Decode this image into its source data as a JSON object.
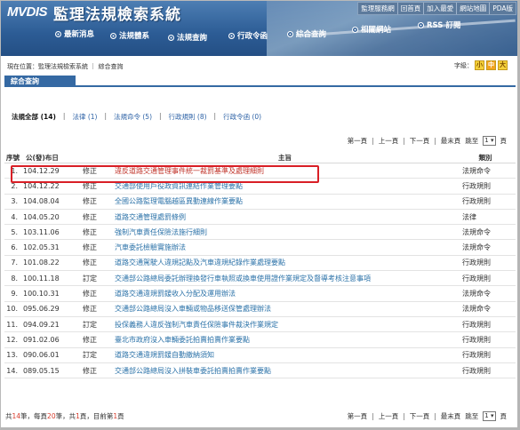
{
  "header": {
    "logo": "MVDIS",
    "title": "監理法規檢索系統",
    "top_links": [
      "監理服務網",
      "回首頁",
      "加入最愛",
      "網站地圖",
      "PDA版"
    ]
  },
  "nav": [
    {
      "label": "最新消息"
    },
    {
      "label": "法規體系"
    },
    {
      "label": "法規查詢"
    },
    {
      "label": "行政令函"
    },
    {
      "label": "綜合查詢"
    },
    {
      "label": "相關網站"
    },
    {
      "label": "RSS 訂閱"
    }
  ],
  "breadcrumb": "現在位置：監理法規檢索系統 ｜ 綜合查詢",
  "font_size": {
    "label": "字級：",
    "options": [
      "小",
      "中",
      "大"
    ],
    "active": 1
  },
  "section_title": "綜合查詢",
  "filters": [
    {
      "label": "法規全部 (14)",
      "current": true
    },
    {
      "label": "法律 (1)",
      "current": false
    },
    {
      "label": "法規命令 (5)",
      "current": false
    },
    {
      "label": "行政規則 (8)",
      "current": false
    },
    {
      "label": "行政令函 (0)",
      "current": false
    }
  ],
  "pager": {
    "first": "第一頁",
    "prev": "上一頁",
    "next": "下一頁",
    "last": "最末頁",
    "jump": "跳至",
    "page": "1",
    "page_suffix": "頁"
  },
  "table": {
    "headers": {
      "no": "序號",
      "date": "公(發)布日",
      "action": "",
      "title": "主旨",
      "category": "類別"
    },
    "rows": [
      {
        "no": "1.",
        "date": "104.12.29",
        "action": "修正",
        "title": "違反道路交通管理事件統一裁罰基準及處理細則",
        "category": "法規命令"
      },
      {
        "no": "2.",
        "date": "104.12.22",
        "action": "修正",
        "title": "交通部使用戶役政資訊連結作業管理要點",
        "category": "行政規則"
      },
      {
        "no": "3.",
        "date": "104.08.04",
        "action": "修正",
        "title": "全國公路監理電腦越區異動連線作業要點",
        "category": "行政規則"
      },
      {
        "no": "4.",
        "date": "104.05.20",
        "action": "修正",
        "title": "道路交通管理處罰條例",
        "category": "法律"
      },
      {
        "no": "5.",
        "date": "103.11.06",
        "action": "修正",
        "title": "強制汽車責任保險法施行細則",
        "category": "法規命令"
      },
      {
        "no": "6.",
        "date": "102.05.31",
        "action": "修正",
        "title": "汽車委託檢驗實施辦法",
        "category": "法規命令"
      },
      {
        "no": "7.",
        "date": "101.08.22",
        "action": "修正",
        "title": "道路交通駕駛人違規記點及汽車違規紀錄作業處理要點",
        "category": "行政規則"
      },
      {
        "no": "8.",
        "date": "100.11.18",
        "action": "訂定",
        "title": "交通部公路總局委託辦理換發行車執照或換車使用證作業規定及督導考核注意事項",
        "category": "行政規則"
      },
      {
        "no": "9.",
        "date": "100.10.31",
        "action": "修正",
        "title": "道路交通違規罰鍰收入分配及運用辦法",
        "category": "法規命令"
      },
      {
        "no": "10.",
        "date": "095.06.29",
        "action": "修正",
        "title": "交通部公路總局沒入車輛或物品移送保管處理辦法",
        "category": "法規命令"
      },
      {
        "no": "11.",
        "date": "094.09.21",
        "action": "訂定",
        "title": "投保義務人違反強制汽車責任保險事件裁決作業規定",
        "category": "行政規則"
      },
      {
        "no": "12.",
        "date": "091.02.06",
        "action": "修正",
        "title": "臺北市政府沒入車輛委託拍賣拍賣作業要點",
        "category": "行政規則"
      },
      {
        "no": "13.",
        "date": "090.06.01",
        "action": "訂定",
        "title": "道路交通違規罰鍰自動繳納須知",
        "category": "行政規則"
      },
      {
        "no": "14.",
        "date": "089.05.15",
        "action": "修正",
        "title": "交通部公路總局沒入拼裝車委託拍賣拍賣作業要點",
        "category": "行政規則"
      }
    ]
  },
  "summary": {
    "p1": "共",
    "total": "14",
    "p2": "筆，每頁",
    "per_page": "20",
    "p3": "筆，共",
    "pages": "1",
    "p4": "頁，目前第",
    "current": "1",
    "p5": "頁"
  }
}
